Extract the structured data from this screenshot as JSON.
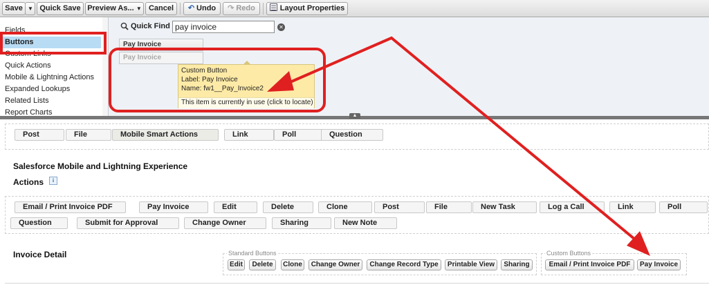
{
  "toolbar": {
    "save": "Save",
    "quick_save": "Quick Save",
    "preview_as": "Preview As...",
    "cancel": "Cancel",
    "undo": "Undo",
    "redo": "Redo",
    "layout_properties": "Layout Properties"
  },
  "palette": {
    "categories": [
      "Fields",
      "Buttons",
      "Custom Links",
      "Quick Actions",
      "Mobile & Lightning Actions",
      "Expanded Lookups",
      "Related Lists",
      "Report Charts"
    ],
    "selected_category": "Buttons",
    "quick_find_label": "Quick Find",
    "quick_find_value": "pay invoice",
    "items": [
      "Pay Invoice",
      "Pay Invoice"
    ],
    "tooltip": {
      "type": "Custom Button",
      "label": "Label: Pay Invoice",
      "name": "Name: fw1__Pay_Invoice2",
      "note": "This item is currently in use (click to locate)"
    }
  },
  "feed_actions": [
    "Post",
    "File",
    "Mobile Smart Actions",
    "Link",
    "Poll",
    "Question"
  ],
  "mobile_section": {
    "title": "Salesforce Mobile and Lightning Experience",
    "title_line2": "Actions",
    "row1": [
      "Email / Print Invoice PDF",
      "Pay Invoice",
      "Edit",
      "Delete",
      "Clone",
      "Post",
      "File",
      "New Task",
      "Log a Call",
      "Link",
      "Poll"
    ],
    "row2": [
      "Question",
      "Submit for Approval",
      "Change Owner",
      "Sharing",
      "New Note"
    ]
  },
  "detail_section": {
    "title": "Invoice Detail",
    "standard_label": "Standard Buttons",
    "standard_buttons": [
      "Edit",
      "Delete",
      "Clone",
      "Change Owner",
      "Change Record Type",
      "Printable View",
      "Sharing"
    ],
    "custom_label": "Custom Buttons",
    "custom_buttons": [
      "Email / Print Invoice PDF",
      "Pay Invoice"
    ]
  },
  "colors": {
    "annotation_red": "#e02020",
    "selection_blue": "#b8dcf4",
    "tooltip_yellow": "#fdeaa6"
  }
}
